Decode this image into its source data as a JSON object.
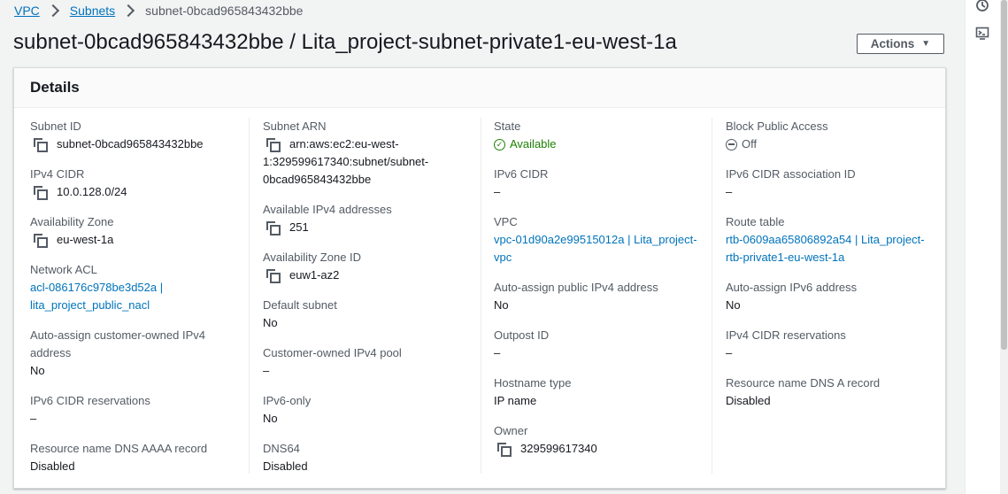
{
  "breadcrumb": {
    "vpc": "VPC",
    "subnets": "Subnets",
    "current": "subnet-0bcad965843432bbe"
  },
  "page": {
    "title": "subnet-0bcad965843432bbe / Lita_project-subnet-private1-eu-west-1a",
    "actions_label": "Actions"
  },
  "details": {
    "title": "Details",
    "subnet_id": {
      "label": "Subnet ID",
      "value": "subnet-0bcad965843432bbe"
    },
    "ipv4_cidr": {
      "label": "IPv4 CIDR",
      "value": "10.0.128.0/24"
    },
    "availability_zone": {
      "label": "Availability Zone",
      "value": "eu-west-1a"
    },
    "network_acl": {
      "label": "Network ACL",
      "value_line1": "acl-086176c978be3d52a |",
      "value_line2": "lita_project_public_nacl"
    },
    "auto_assign_customer_owned": {
      "label": "Auto-assign customer-owned IPv4 address",
      "value": "No"
    },
    "ipv6_cidr_reservations": {
      "label": "IPv6 CIDR reservations",
      "value": "–"
    },
    "dns_aaaa": {
      "label": "Resource name DNS AAAA record",
      "value": "Disabled"
    },
    "subnet_arn": {
      "label": "Subnet ARN",
      "value_line1": "arn:aws:ec2:eu-west-",
      "value_line2": "1:329599617340:subnet/subnet-",
      "value_line3": "0bcad965843432bbe"
    },
    "available_ipv4": {
      "label": "Available IPv4 addresses",
      "value": "251"
    },
    "availability_zone_id": {
      "label": "Availability Zone ID",
      "value": "euw1-az2"
    },
    "default_subnet": {
      "label": "Default subnet",
      "value": "No"
    },
    "customer_owned_pool": {
      "label": "Customer-owned IPv4 pool",
      "value": "–"
    },
    "ipv6_only": {
      "label": "IPv6-only",
      "value": "No"
    },
    "dns64": {
      "label": "DNS64",
      "value": "Disabled"
    },
    "state": {
      "label": "State",
      "value": "Available"
    },
    "ipv6_cidr": {
      "label": "IPv6 CIDR",
      "value": "–"
    },
    "vpc": {
      "label": "VPC",
      "value_line1": "vpc-01d90a2e99515012a | Lita_project-",
      "value_line2": "vpc"
    },
    "auto_assign_public_ipv4": {
      "label": "Auto-assign public IPv4 address",
      "value": "No"
    },
    "outpost_id": {
      "label": "Outpost ID",
      "value": "–"
    },
    "hostname_type": {
      "label": "Hostname type",
      "value": "IP name"
    },
    "owner": {
      "label": "Owner",
      "value": "329599617340"
    },
    "block_public_access": {
      "label": "Block Public Access",
      "value": "Off"
    },
    "ipv6_cidr_association_id": {
      "label": "IPv6 CIDR association ID",
      "value": "–"
    },
    "route_table": {
      "label": "Route table",
      "value_line1": "rtb-0609aa65806892a54 | Lita_project-",
      "value_line2": "rtb-private1-eu-west-1a"
    },
    "auto_assign_ipv6": {
      "label": "Auto-assign IPv6 address",
      "value": "No"
    },
    "ipv4_cidr_reservations": {
      "label": "IPv4 CIDR reservations",
      "value": "–"
    },
    "dns_a": {
      "label": "Resource name DNS A record",
      "value": "Disabled"
    }
  },
  "icons": {
    "copy": "copy-icon",
    "status_ok": "check-circle-icon",
    "status_off": "minus-circle-icon",
    "side_1": "status-icon",
    "side_2": "cloudshell-icon"
  },
  "colors": {
    "link": "#0073bb",
    "success": "#1d8102",
    "text": "#16191f",
    "label": "#545b64"
  }
}
